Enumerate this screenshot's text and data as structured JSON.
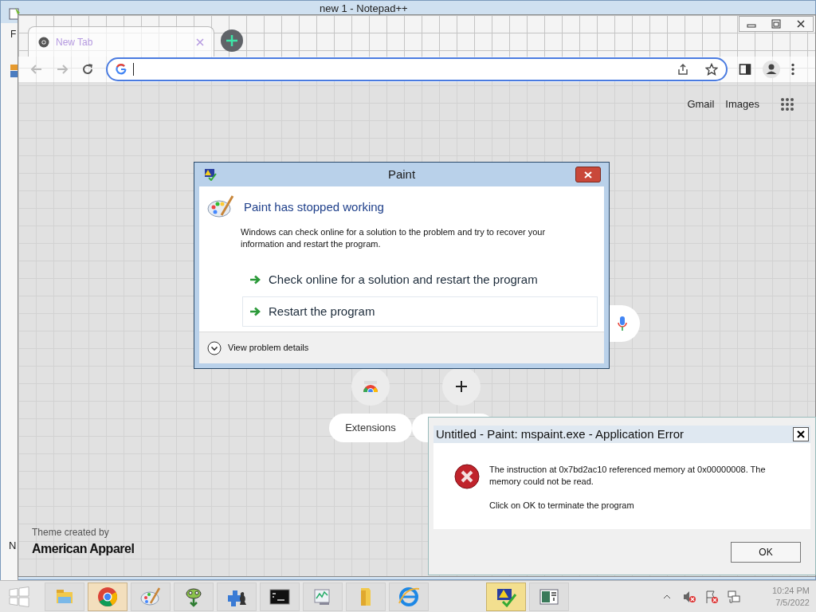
{
  "notepad": {
    "title": "new 1 - Notepad++",
    "menu_letter": "F",
    "status_letter": "N"
  },
  "browser": {
    "tabs": [
      {
        "label": "New Tab",
        "selected": true
      }
    ],
    "top_links": [
      "Gmail",
      "Images"
    ],
    "shortcuts": [
      {
        "kind": "extension",
        "label": "Extensions"
      },
      {
        "kind": "add"
      }
    ],
    "theme_credit": "Theme created by",
    "theme_author": "American Apparel"
  },
  "wer_dialog": {
    "title": "Paint",
    "heading": "Paint has stopped working",
    "message": "Windows can check online for a solution to the problem and try to recover your information and restart the program.",
    "options": [
      {
        "label": "Check online for a solution and restart the program",
        "selected": false
      },
      {
        "label": "Restart the program",
        "selected": true
      }
    ],
    "details": "View problem details"
  },
  "error_dialog": {
    "title": "Untitled - Paint: mspaint.exe - Application Error",
    "message": "The instruction at 0x7bd2ac10 referenced memory at 0x00000008. The memory could not be read.",
    "hint": "Click on OK to terminate the program",
    "button": "OK"
  },
  "taskbar": {
    "apps": [
      {
        "kind": "explorer",
        "active": false
      },
      {
        "kind": "chrome",
        "active": true
      },
      {
        "kind": "paint",
        "active": false
      },
      {
        "kind": "notepadpp",
        "active": false
      },
      {
        "kind": "games",
        "active": false
      },
      {
        "kind": "cmd",
        "active": false
      },
      {
        "kind": "monitor",
        "active": false
      },
      {
        "kind": "folder",
        "active": false
      },
      {
        "kind": "ie",
        "active": false
      },
      {
        "kind": "report",
        "active": true
      },
      {
        "kind": "viewer",
        "active": false
      }
    ],
    "clock": {
      "time": "10:24 PM",
      "date": "7/5/2022"
    }
  }
}
